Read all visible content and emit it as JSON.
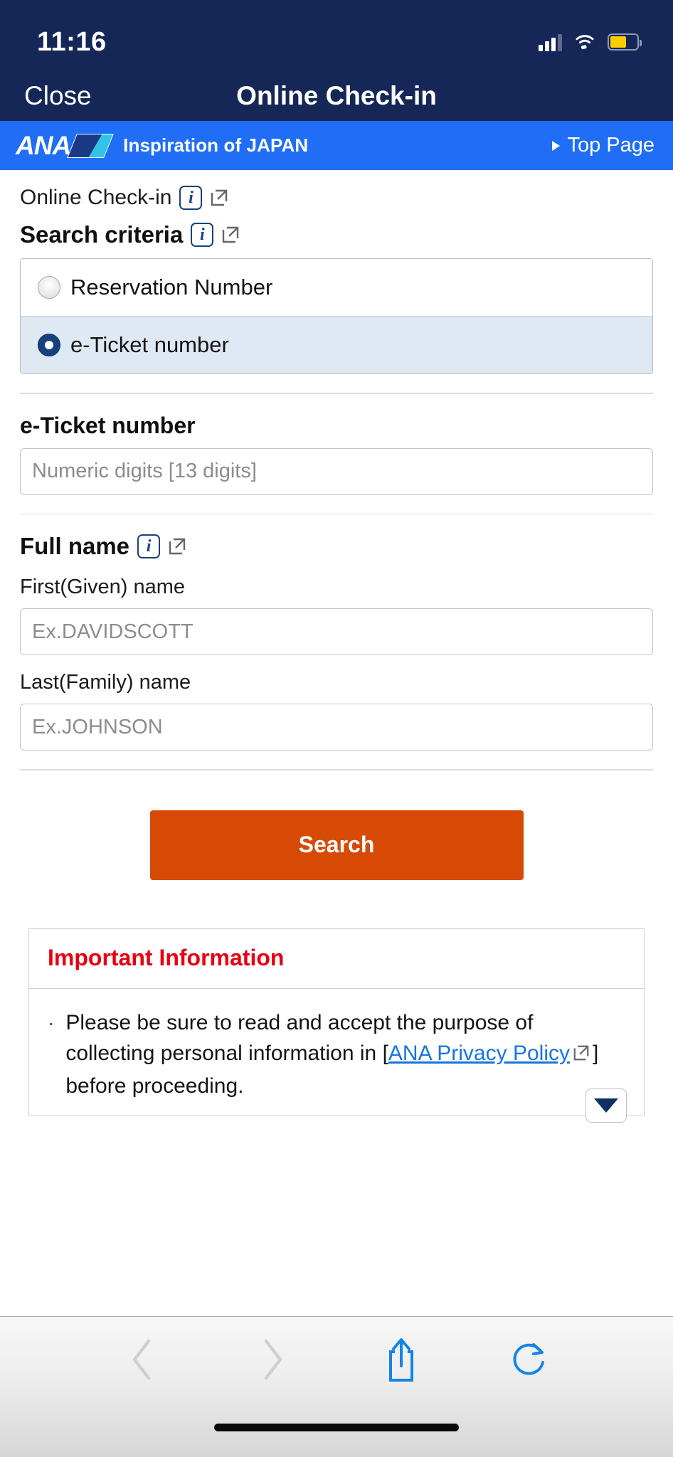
{
  "status_bar": {
    "time": "11:16",
    "icons": [
      "cellular-signal-icon",
      "wifi-icon",
      "battery-icon"
    ]
  },
  "nav_bar": {
    "close_label": "Close",
    "title": "Online Check-in"
  },
  "ana_bar": {
    "logo_text": "ANA",
    "tagline": "Inspiration of JAPAN",
    "top_page_label": "Top Page"
  },
  "breadcrumb": {
    "label": "Online Check-in"
  },
  "search_criteria": {
    "heading": "Search criteria",
    "options": [
      {
        "label": "Reservation Number",
        "selected": false
      },
      {
        "label": "e-Ticket number",
        "selected": true
      }
    ]
  },
  "eticket": {
    "label": "e-Ticket number",
    "placeholder": "Numeric digits [13 digits]",
    "value": ""
  },
  "full_name": {
    "heading": "Full name",
    "first": {
      "label": "First(Given) name",
      "placeholder": "Ex.DAVIDSCOTT",
      "value": ""
    },
    "last": {
      "label": "Last(Family) name",
      "placeholder": "Ex.JOHNSON",
      "value": ""
    }
  },
  "search_button": {
    "label": "Search",
    "color": "#d64a06"
  },
  "notice": {
    "heading": "Important Information",
    "heading_color": "#e60012",
    "bullet": "·",
    "text_before_link": "Please be sure to read and accept the purpose of collecting personal information in [",
    "link_label": "ANA Privacy Policy",
    "text_after_link": "] before proceeding."
  },
  "toolbar": {
    "back_label": "back-icon",
    "forward_label": "forward-icon",
    "share_label": "share-icon",
    "reload_label": "reload-icon"
  }
}
